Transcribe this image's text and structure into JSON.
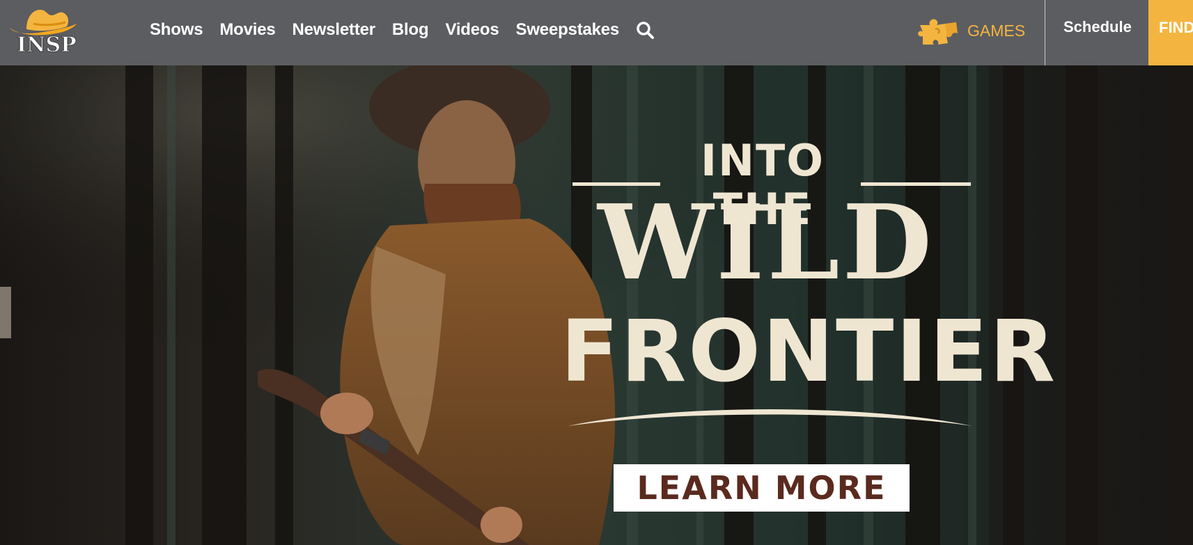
{
  "header": {
    "logo_text": "INSP",
    "nav": [
      {
        "label": "Shows"
      },
      {
        "label": "Movies"
      },
      {
        "label": "Newsletter"
      },
      {
        "label": "Blog"
      },
      {
        "label": "Videos"
      },
      {
        "label": "Sweepstakes"
      }
    ],
    "search_icon": "search-icon",
    "games_icon": "puzzle-icon",
    "games_label": "GAMES",
    "schedule_label": "Schedule",
    "find_label": "FIND"
  },
  "hero": {
    "title_line1": "INTO THE",
    "title_line2": "WILD",
    "title_line3": "FRONTIER",
    "cta_label": "LEARN MORE"
  },
  "colors": {
    "header_bg": "#5c5d60",
    "accent": "#f4b540",
    "title": "#efe6d2",
    "cta_text": "#5a2a1e"
  }
}
